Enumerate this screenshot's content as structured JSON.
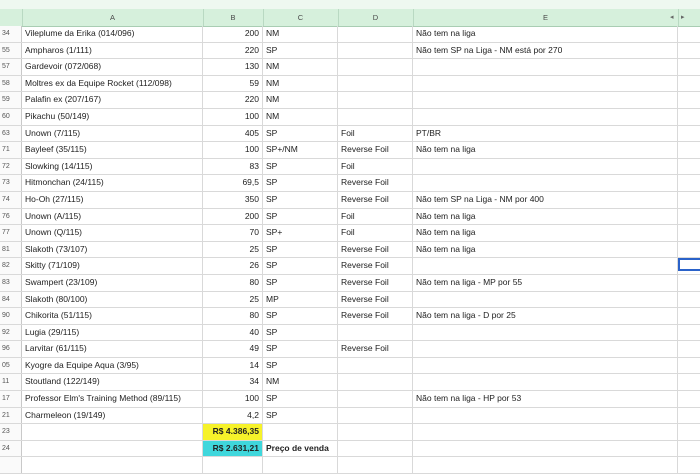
{
  "columns": [
    "A",
    "B",
    "C",
    "D",
    "E"
  ],
  "rows": [
    {
      "num": "34",
      "a": "Vileplume da Erika (014/096)",
      "b": "200",
      "c": "NM",
      "d": "",
      "e": "Não tem na liga"
    },
    {
      "num": "55",
      "a": "Ampharos (1/111)",
      "b": "220",
      "c": "SP",
      "d": "",
      "e": "Não tem SP na Liga - NM está por 270"
    },
    {
      "num": "57",
      "a": "Gardevoir (072/068)",
      "b": "130",
      "c": "NM",
      "d": "",
      "e": ""
    },
    {
      "num": "58",
      "a": "Moltres ex da Equipe Rocket (112/098)",
      "b": "59",
      "c": "NM",
      "d": "",
      "e": ""
    },
    {
      "num": "59",
      "a": "Palafin ex (207/167)",
      "b": "220",
      "c": "NM",
      "d": "",
      "e": ""
    },
    {
      "num": "60",
      "a": "Pikachu (50/149)",
      "b": "100",
      "c": "NM",
      "d": "",
      "e": ""
    },
    {
      "num": "63",
      "a": "Unown (7/115)",
      "b": "405",
      "c": "SP",
      "d": "Foil",
      "e": "PT/BR"
    },
    {
      "num": "71",
      "a": "Bayleef (35/115)",
      "b": "100",
      "c": "SP+/NM",
      "d": "Reverse Foil",
      "e": "Não tem na liga"
    },
    {
      "num": "72",
      "a": "Slowking (14/115)",
      "b": "83",
      "c": "SP",
      "d": "Foil",
      "e": ""
    },
    {
      "num": "73",
      "a": "Hitmonchan (24/115)",
      "b": "69,5",
      "c": "SP",
      "d": "Reverse Foil",
      "e": ""
    },
    {
      "num": "74",
      "a": "Ho-Oh (27/115)",
      "b": "350",
      "c": "SP",
      "d": "Reverse Foil",
      "e": "Não tem SP na Liga - NM por 400"
    },
    {
      "num": "76",
      "a": "Unown (A/115)",
      "b": "200",
      "c": "SP",
      "d": "Foil",
      "e": "Não tem na liga"
    },
    {
      "num": "77",
      "a": "Unown (Q/115)",
      "b": "70",
      "c": "SP+",
      "d": "Foil",
      "e": "Não tem na liga"
    },
    {
      "num": "81",
      "a": "Slakoth (73/107)",
      "b": "25",
      "c": "SP",
      "d": "Reverse Foil",
      "e": "Não tem na liga"
    },
    {
      "num": "82",
      "a": "Skitty (71/109)",
      "b": "26",
      "c": "SP",
      "d": "Reverse Foil",
      "e": ""
    },
    {
      "num": "83",
      "a": "Swampert (23/109)",
      "b": "80",
      "c": "SP",
      "d": "Reverse Foil",
      "e": "Não tem na liga - MP por 55"
    },
    {
      "num": "84",
      "a": "Slakoth (80/100)",
      "b": "25",
      "c": "MP",
      "d": "Reverse Foil",
      "e": ""
    },
    {
      "num": "90",
      "a": "Chikorita (51/115)",
      "b": "80",
      "c": "SP",
      "d": "Reverse Foil",
      "e": "Não tem na liga - D por 25"
    },
    {
      "num": "92",
      "a": "Lugia (29/115)",
      "b": "40",
      "c": "SP",
      "d": "",
      "e": ""
    },
    {
      "num": "96",
      "a": "Larvitar (61/115)",
      "b": "49",
      "c": "SP",
      "d": "Reverse Foil",
      "e": ""
    },
    {
      "num": "05",
      "a": "Kyogre da Equipe Aqua (3/95)",
      "b": "14",
      "c": "SP",
      "d": "",
      "e": ""
    },
    {
      "num": "11",
      "a": "Stoutland (122/149)",
      "b": "34",
      "c": "NM",
      "d": "",
      "e": ""
    },
    {
      "num": "17",
      "a": "Professor Elm's Training Method (89/115)",
      "b": "100",
      "c": "SP",
      "d": "",
      "e": "Não tem na liga - HP por 53"
    },
    {
      "num": "21",
      "a": "Charmeleon (19/149)",
      "b": "4,2",
      "c": "SP",
      "d": "",
      "e": ""
    }
  ],
  "totals": {
    "row23_num": "23",
    "row24_num": "24",
    "total_value": "R$ 4.386,35",
    "sale_value": "R$ 2.631,21",
    "sale_label": "Preço de venda"
  },
  "icons": {
    "scroll_left": "◂",
    "scroll_right": "▸"
  }
}
